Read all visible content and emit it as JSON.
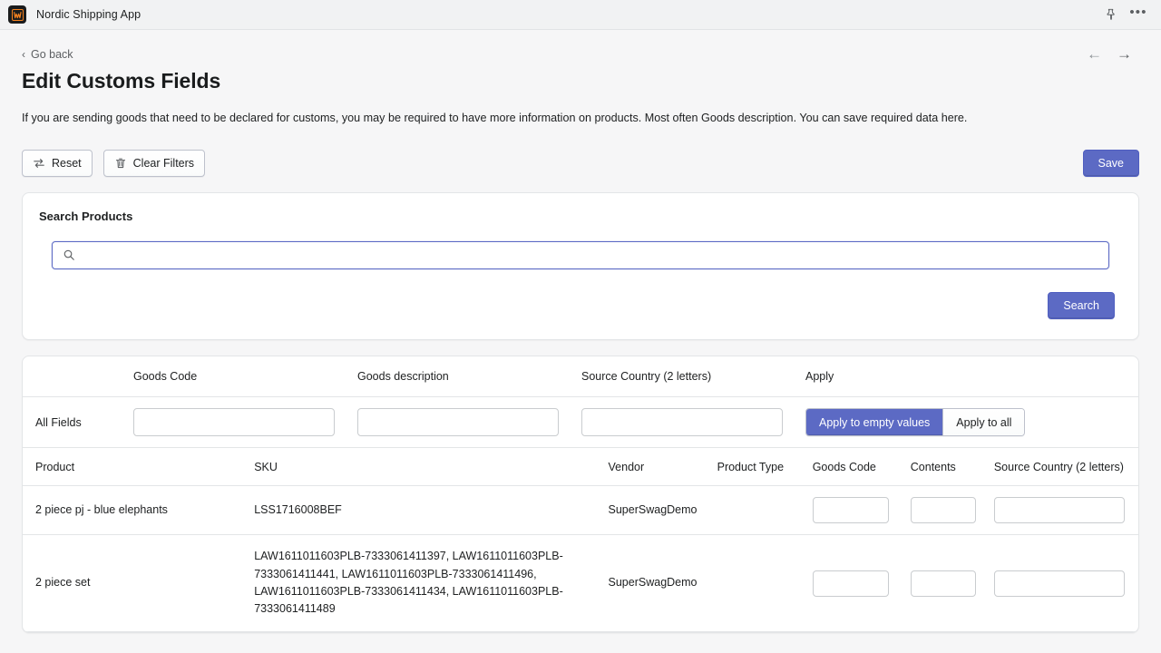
{
  "topbar": {
    "app_name": "Nordic Shipping App",
    "logo_letter": "W",
    "logo_bg": "#1a1c1d",
    "logo_fg": "#f58220",
    "pin_icon": "pin-icon",
    "more_icon": "ellipsis-icon",
    "more_glyph": "•••"
  },
  "header": {
    "go_back": "Go back",
    "back_chevron": "‹",
    "title": "Edit Customs Fields",
    "description": "If you are sending goods that need to be declared for customs, you may be required to have more information on products. Most often Goods description. You can save required data here.",
    "nav_prev": "←",
    "nav_next": "→"
  },
  "toolbar": {
    "reset_label": "Reset",
    "clear_filters_label": "Clear Filters",
    "save_label": "Save",
    "primary_color": "#5c6ac4"
  },
  "search_card": {
    "title": "Search Products",
    "input_value": "",
    "input_placeholder": "",
    "search_button": "Search"
  },
  "filters": {
    "headers": [
      "Goods Code",
      "Goods description",
      "Source Country (2 letters)",
      "Apply"
    ],
    "row_label": "All Fields",
    "goods_code_value": "",
    "goods_description_value": "",
    "source_country_value": "",
    "apply_empty_label": "Apply to empty values",
    "apply_all_label": "Apply to all",
    "apply_empty_active": true
  },
  "products_table": {
    "headers": [
      "Product",
      "SKU",
      "Vendor",
      "Product Type",
      "Goods Code",
      "Contents",
      "Source Country (2 letters)"
    ],
    "rows": [
      {
        "product": "2 piece pj - blue elephants",
        "sku": "LSS1716008BEF",
        "vendor": "SuperSwagDemo",
        "product_type": "",
        "goods_code": "",
        "contents": "",
        "source_country": ""
      },
      {
        "product": "2 piece set",
        "sku": "LAW1611011603PLB-7333061411397, LAW1611011603PLB-7333061411441, LAW1611011603PLB-7333061411496, LAW1611011603PLB-7333061411434, LAW1611011603PLB-7333061411489",
        "vendor": "SuperSwagDemo",
        "product_type": "",
        "goods_code": "",
        "contents": "",
        "source_country": ""
      }
    ]
  }
}
